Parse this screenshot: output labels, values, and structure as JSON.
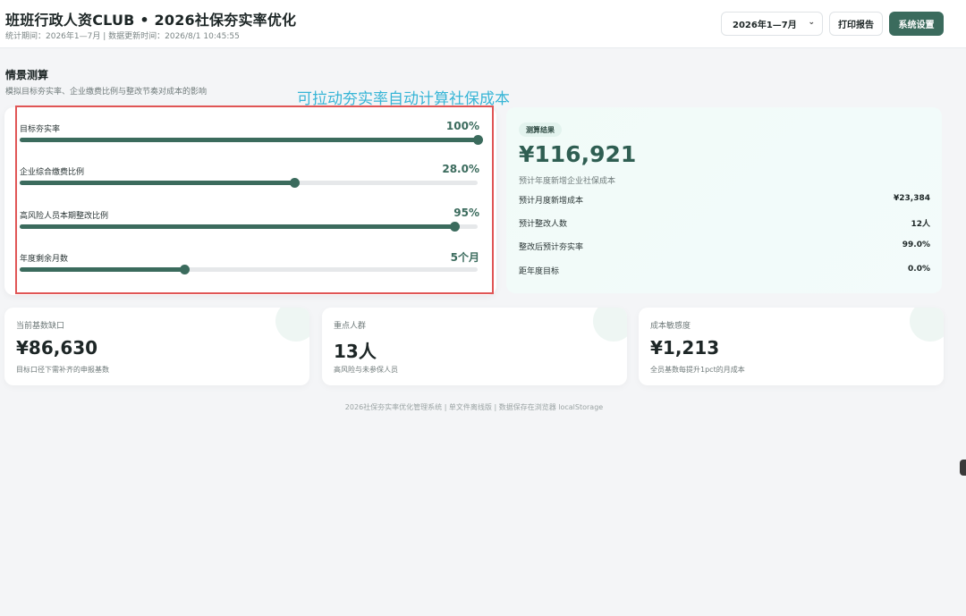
{
  "header": {
    "title": "班班行政人资CLUB • 2026社保夯实率优化",
    "meta": "统计期间：2026年1—7月 | 数据更新时间：2026/8/1 10:45:55",
    "period_select": "2026年1—7月",
    "print_label": "打印报告",
    "settings_label": "系统设置"
  },
  "section": {
    "title": "情景测算",
    "subtitle": "模拟目标夯实率、企业缴费比例与整改节奏对成本的影响",
    "overlay_note": "可拉动夯实率自动计算社保成本"
  },
  "sliders": [
    {
      "label": "目标夯实率",
      "value_text": "100%",
      "level": 1.0
    },
    {
      "label": "企业综合缴费比例",
      "value_text": "28.0%",
      "level": 0.6
    },
    {
      "label": "高风险人员本期整改比例",
      "value_text": "95%",
      "level": 0.95
    },
    {
      "label": "年度剩余月数",
      "value_text": "5个月",
      "level": 0.36
    }
  ],
  "result": {
    "tag": "测算结果",
    "amount": "¥116,921",
    "caption": "预计年度新增企业社保成本",
    "rows": [
      {
        "k": "预计月度新增成本",
        "v": "¥23,384"
      },
      {
        "k": "预计整改人数",
        "v": "12人"
      },
      {
        "k": "整改后预计夯实率",
        "v": "99.0%"
      },
      {
        "k": "距年度目标",
        "v": "0.0%"
      }
    ]
  },
  "kpis": [
    {
      "label": "当前基数缺口",
      "value": "¥86,630",
      "note": "目标口径下需补齐的申报基数"
    },
    {
      "label": "重点人群",
      "value": "13人",
      "note": "高风险与未参保人员"
    },
    {
      "label": "成本敏感度",
      "value": "¥1,213",
      "note": "全员基数每提升1pct的月成本"
    }
  ],
  "footer": "2026社保夯实率优化管理系统 | 单文件离线版 | 数据保存在浏览器 localStorage",
  "colors": {
    "accent": "#3b6b5d",
    "highlight_border": "#e05555",
    "overlay_note": "#37b5d6"
  }
}
